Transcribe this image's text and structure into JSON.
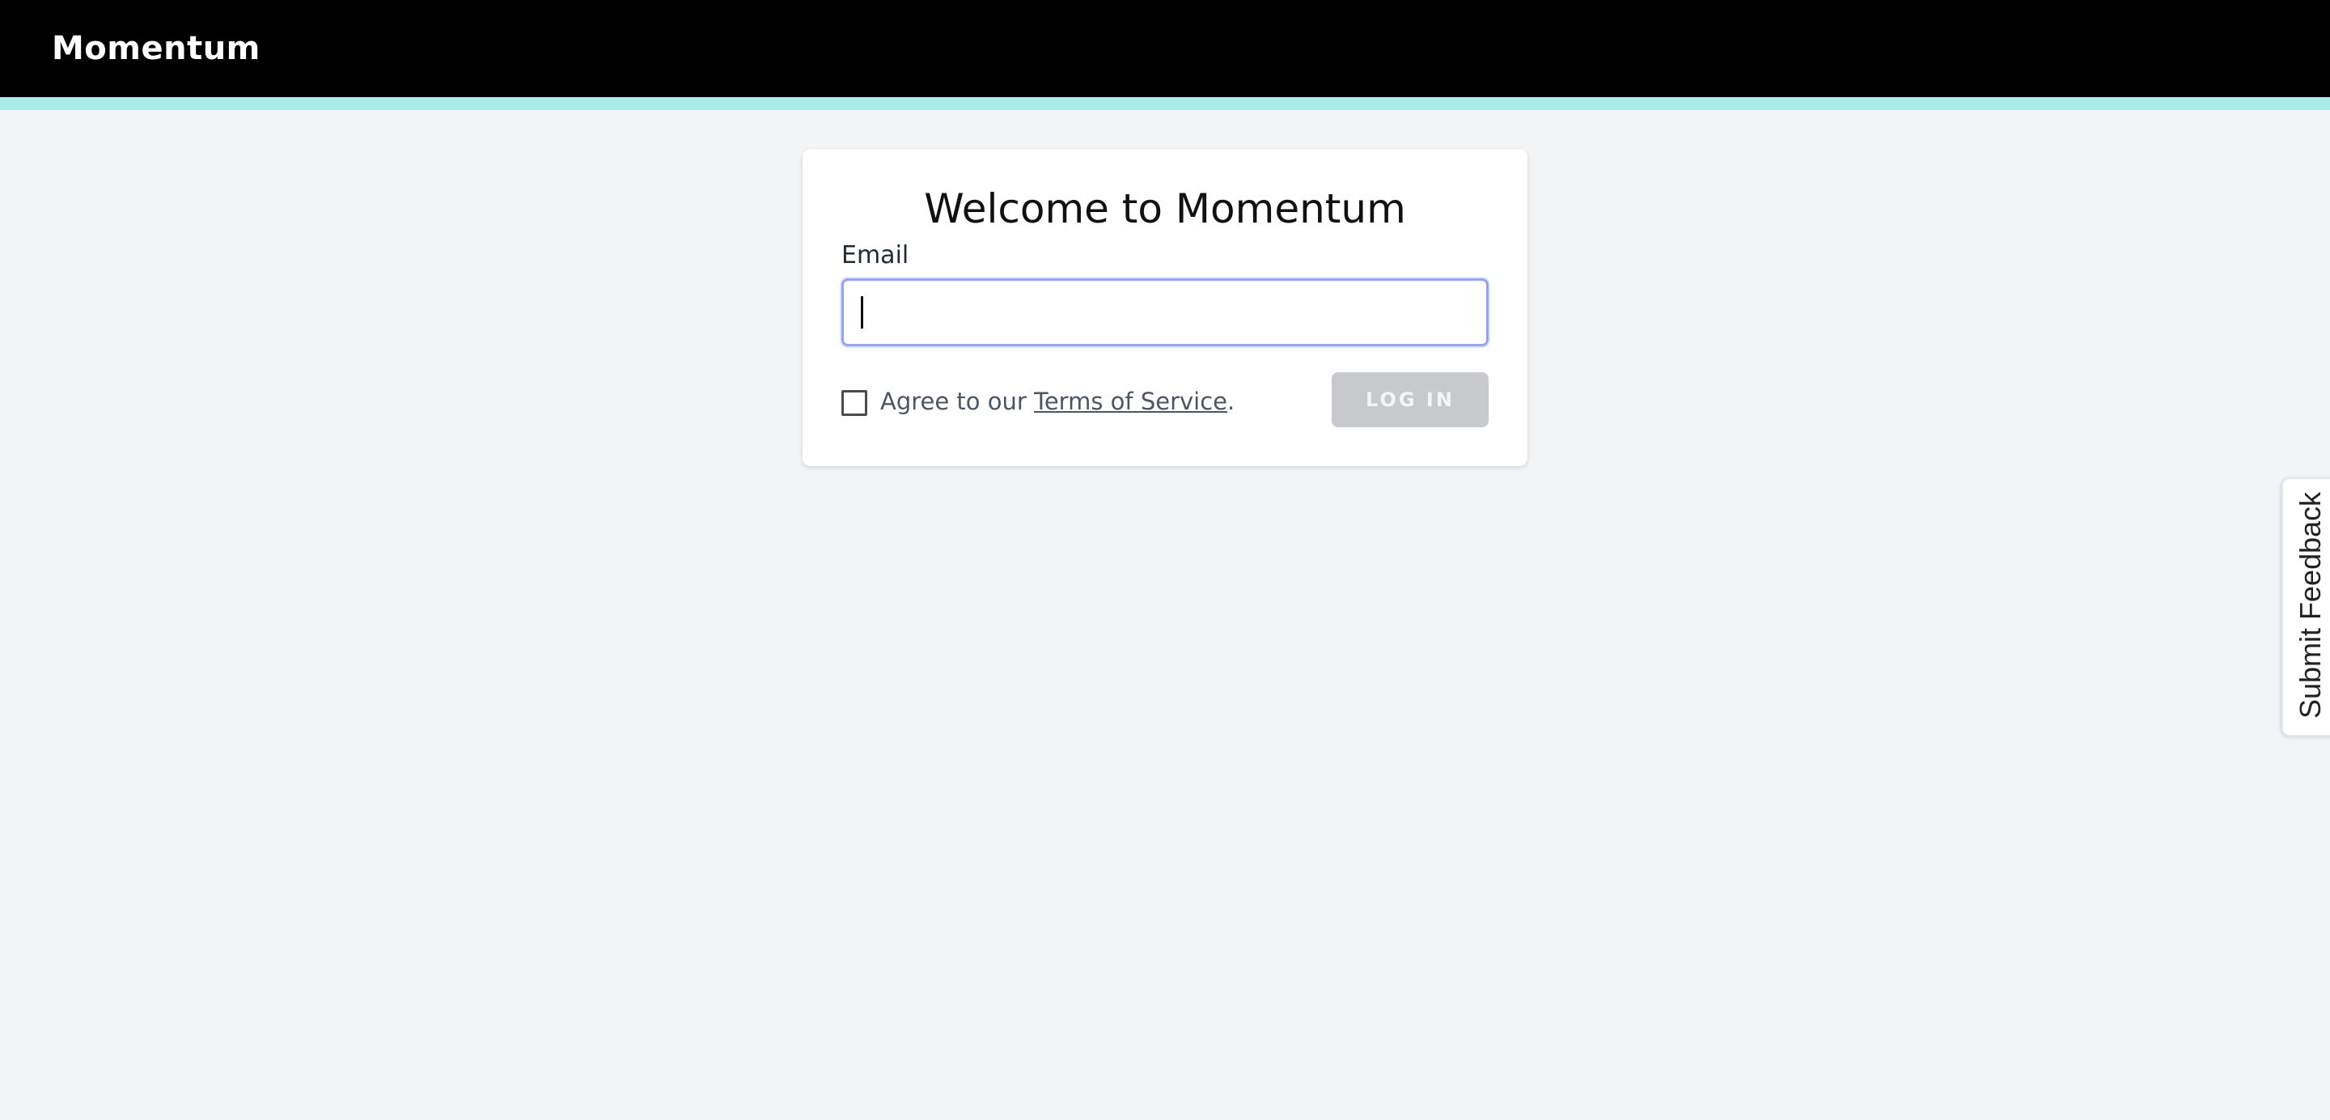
{
  "header": {
    "brand": "Momentum",
    "background_color": "#000000",
    "accent_color": "#a7ece6"
  },
  "login_card": {
    "title": "Welcome to Momentum",
    "email_label": "Email",
    "email_value": "",
    "email_placeholder": "",
    "agree_prefix": "Agree to our ",
    "terms_link": "Terms of Service",
    "agree_suffix": ".",
    "agree_checked": false,
    "login_button": "LOG IN",
    "login_button_state": "disabled"
  },
  "feedback": {
    "label": "Submit Feedback"
  }
}
